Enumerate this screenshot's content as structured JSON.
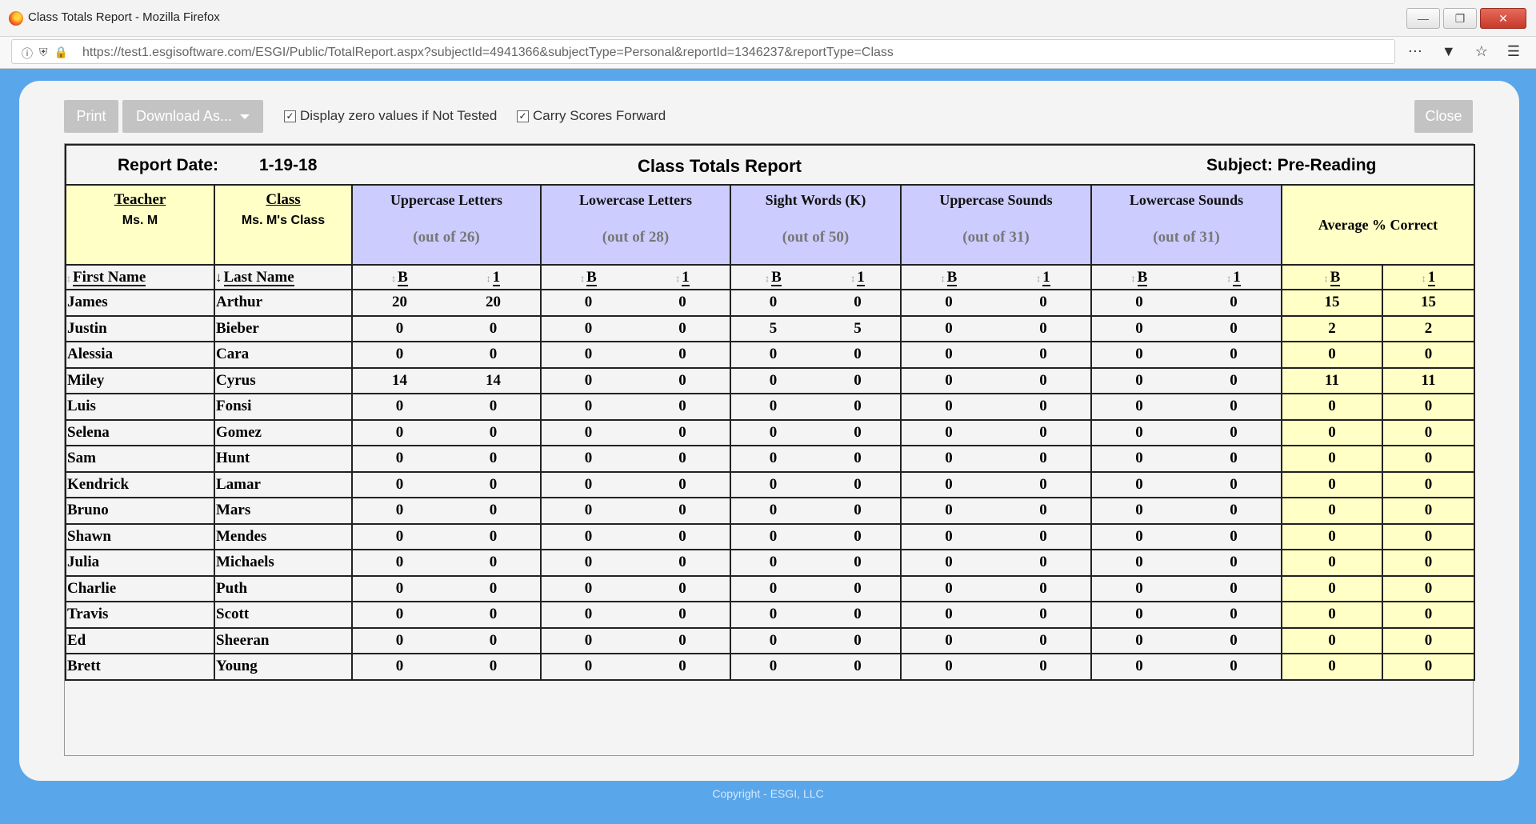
{
  "window": {
    "title": "Class Totals Report - Mozilla Firefox",
    "url": "https://test1.esgisoftware.com/ESGI/Public/TotalReport.aspx?subjectId=4941366&subjectType=Personal&reportId=1346237&reportType=Class"
  },
  "toolbar": {
    "print_label": "Print",
    "download_label": "Download As...",
    "zero_values_label": "Display zero values if Not Tested",
    "zero_values_checked": true,
    "carry_forward_label": "Carry Scores Forward",
    "carry_forward_checked": true,
    "close_label": "Close"
  },
  "report": {
    "report_date_label": "Report Date:",
    "report_date": "1-19-18",
    "title": "Class Totals Report",
    "subject": "Subject: Pre-Reading",
    "teacher_label": "Teacher",
    "teacher": "Ms. M",
    "class_label": "Class",
    "class_name": "Ms. M's Class",
    "tests": [
      {
        "name": "Uppercase Letters",
        "out_of": "(out of 26)"
      },
      {
        "name": "Lowercase Letters",
        "out_of": "(out of 28)"
      },
      {
        "name": "Sight Words (K)",
        "out_of": "(out of 50)"
      },
      {
        "name": "Uppercase Sounds",
        "out_of": "(out of 31)"
      },
      {
        "name": "Lowercase Sounds",
        "out_of": "(out of 31)"
      }
    ],
    "average_label": "Average % Correct",
    "first_name_header": "First Name",
    "last_name_header": "Last Name",
    "col_b": "B",
    "col_1": "1",
    "students": [
      {
        "first": "James",
        "last": "Arthur",
        "scores": [
          20,
          20,
          0,
          0,
          0,
          0,
          0,
          0,
          0,
          0
        ],
        "avg": [
          15,
          15
        ]
      },
      {
        "first": "Justin",
        "last": "Bieber",
        "scores": [
          0,
          0,
          0,
          0,
          5,
          5,
          0,
          0,
          0,
          0
        ],
        "avg": [
          2,
          2
        ]
      },
      {
        "first": "Alessia",
        "last": "Cara",
        "scores": [
          0,
          0,
          0,
          0,
          0,
          0,
          0,
          0,
          0,
          0
        ],
        "avg": [
          0,
          0
        ]
      },
      {
        "first": "Miley",
        "last": "Cyrus",
        "scores": [
          14,
          14,
          0,
          0,
          0,
          0,
          0,
          0,
          0,
          0
        ],
        "avg": [
          11,
          11
        ]
      },
      {
        "first": "Luis",
        "last": "Fonsi",
        "scores": [
          0,
          0,
          0,
          0,
          0,
          0,
          0,
          0,
          0,
          0
        ],
        "avg": [
          0,
          0
        ]
      },
      {
        "first": "Selena",
        "last": "Gomez",
        "scores": [
          0,
          0,
          0,
          0,
          0,
          0,
          0,
          0,
          0,
          0
        ],
        "avg": [
          0,
          0
        ]
      },
      {
        "first": "Sam",
        "last": "Hunt",
        "scores": [
          0,
          0,
          0,
          0,
          0,
          0,
          0,
          0,
          0,
          0
        ],
        "avg": [
          0,
          0
        ]
      },
      {
        "first": "Kendrick",
        "last": "Lamar",
        "scores": [
          0,
          0,
          0,
          0,
          0,
          0,
          0,
          0,
          0,
          0
        ],
        "avg": [
          0,
          0
        ]
      },
      {
        "first": "Bruno",
        "last": "Mars",
        "scores": [
          0,
          0,
          0,
          0,
          0,
          0,
          0,
          0,
          0,
          0
        ],
        "avg": [
          0,
          0
        ]
      },
      {
        "first": "Shawn",
        "last": "Mendes",
        "scores": [
          0,
          0,
          0,
          0,
          0,
          0,
          0,
          0,
          0,
          0
        ],
        "avg": [
          0,
          0
        ]
      },
      {
        "first": "Julia",
        "last": "Michaels",
        "scores": [
          0,
          0,
          0,
          0,
          0,
          0,
          0,
          0,
          0,
          0
        ],
        "avg": [
          0,
          0
        ]
      },
      {
        "first": "Charlie",
        "last": "Puth",
        "scores": [
          0,
          0,
          0,
          0,
          0,
          0,
          0,
          0,
          0,
          0
        ],
        "avg": [
          0,
          0
        ]
      },
      {
        "first": "Travis",
        "last": "Scott",
        "scores": [
          0,
          0,
          0,
          0,
          0,
          0,
          0,
          0,
          0,
          0
        ],
        "avg": [
          0,
          0
        ]
      },
      {
        "first": "Ed",
        "last": "Sheeran",
        "scores": [
          0,
          0,
          0,
          0,
          0,
          0,
          0,
          0,
          0,
          0
        ],
        "avg": [
          0,
          0
        ]
      },
      {
        "first": "Brett",
        "last": "Young",
        "scores": [
          0,
          0,
          0,
          0,
          0,
          0,
          0,
          0,
          0,
          0
        ],
        "avg": [
          0,
          0
        ]
      }
    ]
  },
  "footer": {
    "copyright": "Copyright - ESGI, LLC"
  }
}
